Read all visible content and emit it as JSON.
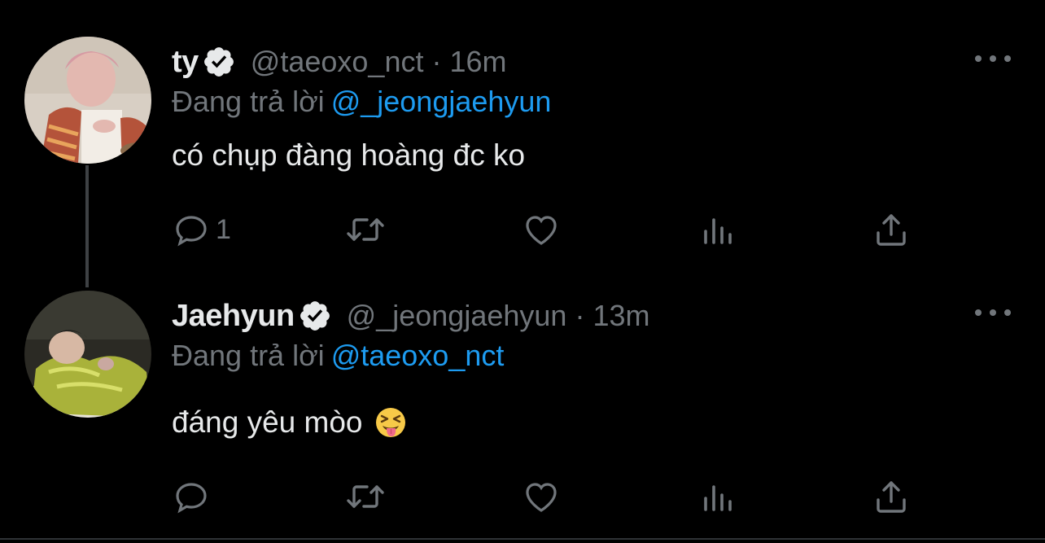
{
  "colors": {
    "background": "#000000",
    "text_primary": "#e7e9ea",
    "text_secondary": "#71767b",
    "accent_link": "#1d9bf0",
    "thread_line": "#3e4144"
  },
  "tweets": [
    {
      "display_name": "ty",
      "verified": true,
      "verified_icon": "verified-badge-icon",
      "handle": "@taeoxo_nct",
      "separator": "·",
      "time": "16m",
      "reply_prefix": "Đang trả lời",
      "reply_mention": "@_jeongjaehyun",
      "text": "có chụp đàng hoàng đc ko",
      "emoji": null,
      "reply_count": "1",
      "actions": [
        "reply-icon",
        "retweet-icon",
        "like-icon",
        "views-icon",
        "share-icon"
      ]
    },
    {
      "display_name": "Jaehyun",
      "verified": true,
      "verified_icon": "verified-badge-icon",
      "handle": "@_jeongjaehyun",
      "separator": "·",
      "time": "13m",
      "reply_prefix": "Đang trả lời",
      "reply_mention": "@taeoxo_nct",
      "text": "đáng yêu mòo",
      "emoji": "squinting-face-with-tongue-emoji",
      "reply_count": "",
      "actions": [
        "reply-icon",
        "retweet-icon",
        "like-icon",
        "views-icon",
        "share-icon"
      ]
    }
  ]
}
